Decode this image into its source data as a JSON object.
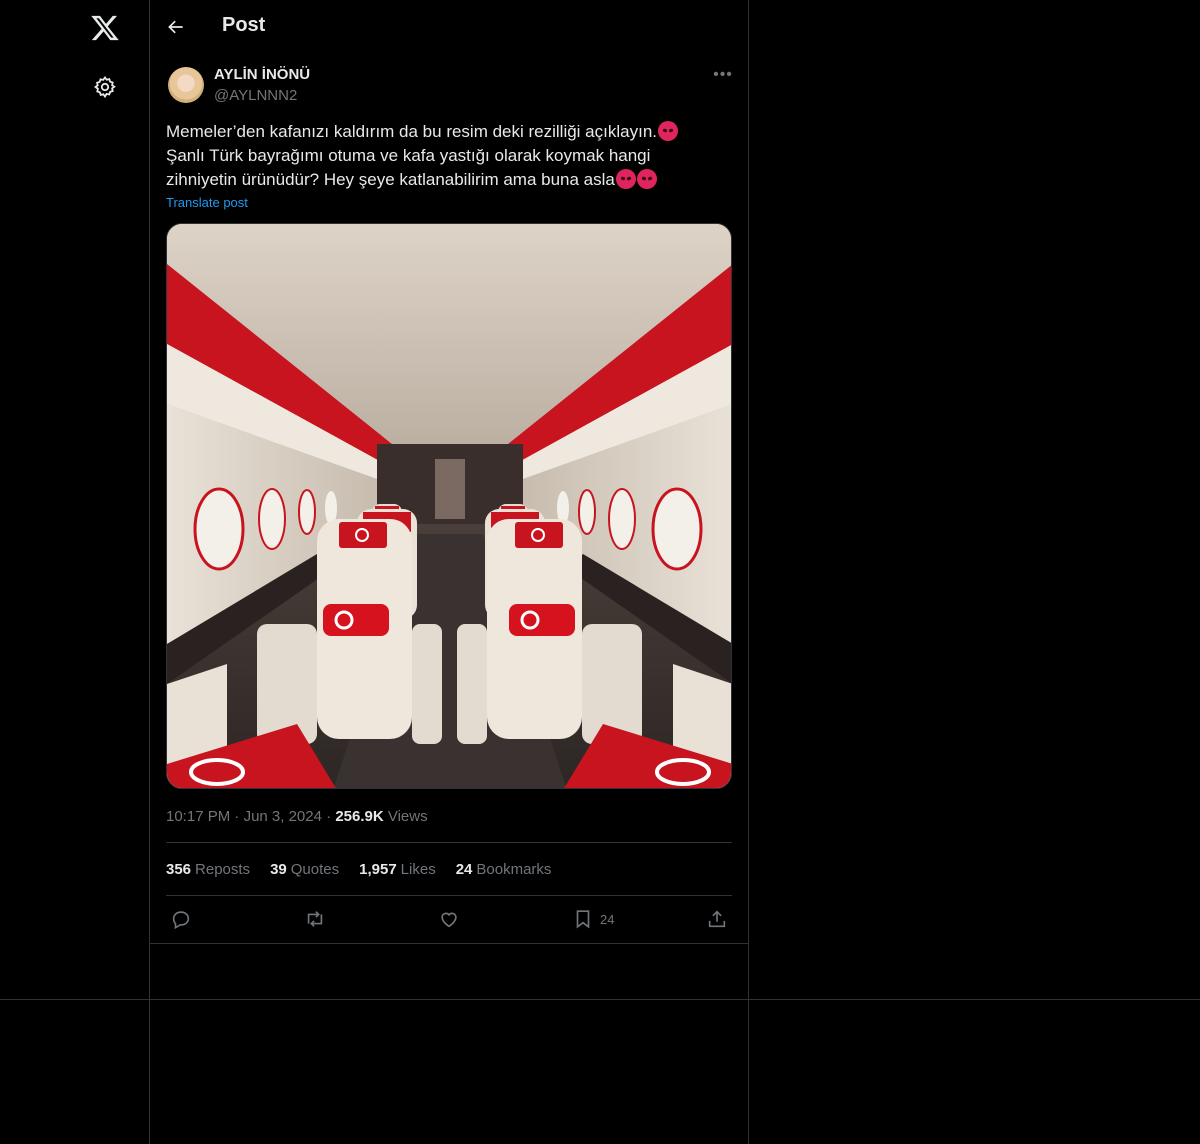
{
  "nav": {
    "logo_icon": "x-logo-icon",
    "settings_icon": "gear-icon"
  },
  "header": {
    "title": "Post"
  },
  "post": {
    "author": {
      "display_name": "AYLİN İNÖNÜ",
      "handle": "@AYLNNN2"
    },
    "text_line1": "Memeler’den kafanızı kaldırım da bu resim deki rezilliği açıklayın.",
    "text_line2": "Şanlı Türk bayrağımı otuma ve kafa yastığı olarak koymak hangi",
    "text_line3": "zihniyetin ürünüdür?  Hey şeye katlanabilirim ama buna asla",
    "translate_label": "Translate post",
    "time": "10:17 PM",
    "date": "Jun 3, 2024",
    "views_count": "256.9K",
    "views_label": "Views",
    "separator": "·",
    "stats": [
      {
        "count": "356",
        "label": "Reposts"
      },
      {
        "count": "39",
        "label": "Quotes"
      },
      {
        "count": "1,957",
        "label": "Likes"
      },
      {
        "count": "24",
        "label": "Bookmarks"
      }
    ],
    "actions": {
      "bookmark_count": "24"
    }
  },
  "colors": {
    "background": "#000000",
    "border": "#2f3336",
    "accent": "#1d9bf0",
    "muted": "#71767b",
    "flag_red": "#e30a17"
  }
}
